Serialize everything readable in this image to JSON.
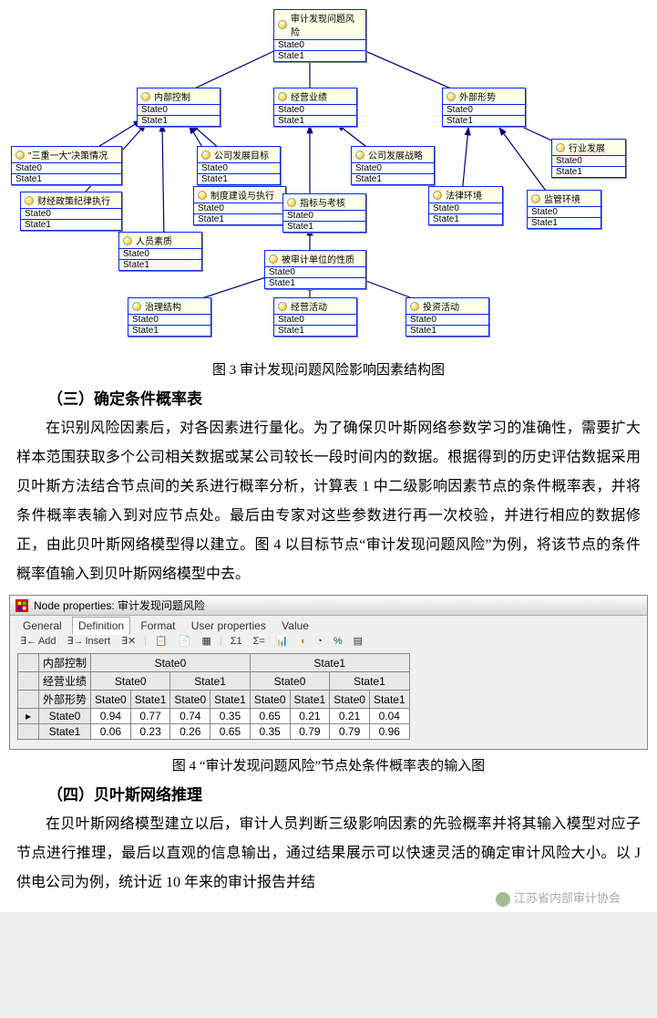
{
  "diagram": {
    "nodes": {
      "root": {
        "title": "审计发现问题风险",
        "states": [
          "State0",
          "State1"
        ]
      },
      "internal": {
        "title": "内部控制",
        "states": [
          "State0",
          "State1"
        ]
      },
      "perf": {
        "title": "经营业绩",
        "states": [
          "State0",
          "State1"
        ]
      },
      "external": {
        "title": "外部形势",
        "states": [
          "State0",
          "State1"
        ]
      },
      "sanzhong": {
        "title": "\"三重一大\"决策情况",
        "states": [
          "State0",
          "State1"
        ]
      },
      "caijing": {
        "title": "财经政策纪律执行",
        "states": [
          "State0",
          "State1"
        ]
      },
      "renyuan": {
        "title": "人员素质",
        "states": [
          "State0",
          "State1"
        ]
      },
      "fazhanmubiao": {
        "title": "公司发展目标",
        "states": [
          "State0",
          "State1"
        ]
      },
      "zhidu": {
        "title": "制度建设与执行",
        "states": [
          "State0",
          "State1"
        ]
      },
      "zhibiao": {
        "title": "指标与考核",
        "states": [
          "State0",
          "State1"
        ]
      },
      "fazhanzhanlue": {
        "title": "公司发展战略",
        "states": [
          "State0",
          "State1"
        ]
      },
      "falv": {
        "title": "法律环境",
        "states": [
          "State0",
          "State1"
        ]
      },
      "jianguan": {
        "title": "监管环境",
        "states": [
          "State0",
          "State1"
        ]
      },
      "hangye": {
        "title": "行业发展",
        "states": [
          "State0",
          "State1"
        ]
      },
      "xingzhi": {
        "title": "被审计单位的性质",
        "states": [
          "State0",
          "State1"
        ]
      },
      "zhili": {
        "title": "治理结构",
        "states": [
          "State0",
          "State1"
        ]
      },
      "jingying": {
        "title": "经营活动",
        "states": [
          "State0",
          "State1"
        ]
      },
      "touzi": {
        "title": "投资活动",
        "states": [
          "State0",
          "State1"
        ]
      }
    }
  },
  "fig3_caption": "图 3  审计发现问题风险影响因素结构图",
  "section3_heading": "（三）确定条件概率表",
  "para1": "在识别风险因素后，对各因素进行量化。为了确保贝叶斯网络参数学习的准确性，需要扩大样本范围获取多个公司相关数据或某公司较长一段时间内的数据。根据得到的历史评估数据采用贝叶斯方法结合节点间的关系进行概率分析，计算表 1 中二级影响因素节点的条件概率表，并将条件概率表输入到对应节点处。最后由专家对这些参数进行再一次校验，并进行相应的数据修正，由此贝叶斯网络模型得以建立。图 4 以目标节点“审计发现问题风险”为例，将该节点的条件概率值输入到贝叶斯网络模型中去。",
  "window": {
    "title": "Node properties: 审计发现问题风险",
    "tabs": [
      "General",
      "Definition",
      "Format",
      "User properties",
      "Value"
    ],
    "selected_tab": "Definition",
    "toolbar": {
      "add": "Add",
      "insert": "Insert"
    }
  },
  "chart_data": {
    "type": "table",
    "title": "条件概率表：审计发现问题风险",
    "row_vars": [
      "内部控制",
      "经营业绩",
      "外部形势"
    ],
    "col_structure": {
      "内部控制": [
        "State0",
        "State1"
      ],
      "经营业绩": [
        "State0",
        "State1"
      ],
      "外部形势": [
        "State0",
        "State1"
      ]
    },
    "rows": [
      {
        "label": "State0",
        "values": [
          0.94,
          0.77,
          0.74,
          0.35,
          0.65,
          0.21,
          0.21,
          0.04
        ]
      },
      {
        "label": "State1",
        "values": [
          0.06,
          0.23,
          0.26,
          0.65,
          0.35,
          0.79,
          0.79,
          0.96
        ]
      }
    ]
  },
  "fig4_caption": "图 4  “审计发现问题风险”节点处条件概率表的输入图",
  "section4_heading": "（四）贝叶斯网络推理",
  "para2": "在贝叶斯网络模型建立以后，审计人员判断三级影响因素的先验概率并将其输入模型对应子节点进行推理，最后以直观的信息输出，通过结果展示可以快速灵活的确定审计风险大小。以 J 供电公司为例，统计近 10 年来的审计报告并结",
  "watermark": "江苏省内部审计协会"
}
